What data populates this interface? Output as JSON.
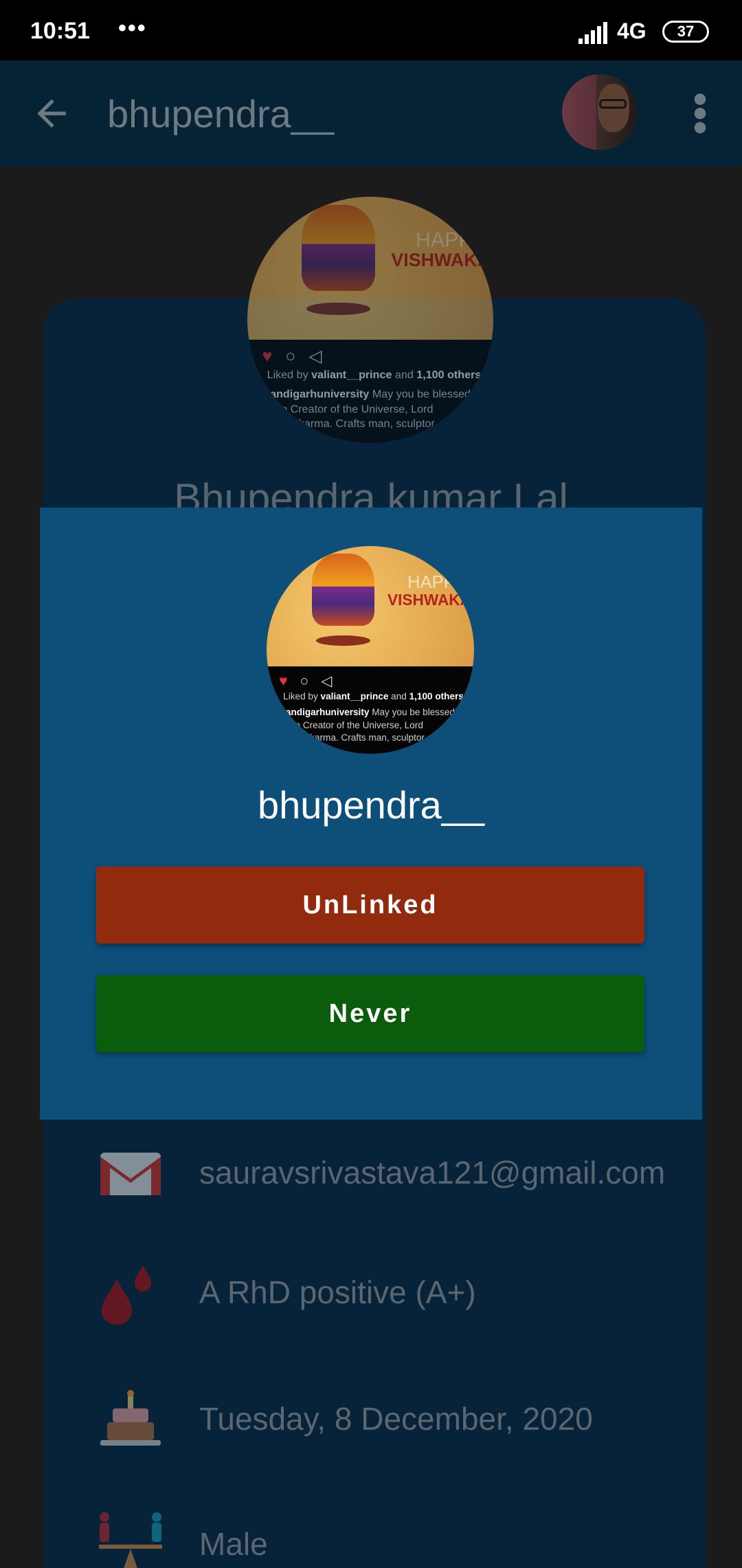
{
  "status_bar": {
    "time": "10:51",
    "dots": "•••",
    "network": "4G",
    "battery": "37"
  },
  "app_bar": {
    "title": "bhupendra__"
  },
  "profile": {
    "name": "Bhupendra kumar Lal",
    "email": "sauravsrivastava121@gmail.com",
    "blood_group": "A RhD positive (A+)",
    "birthday": "Tuesday, 8 December, 2020",
    "gender": "Male"
  },
  "post": {
    "happy": "HAPPY",
    "vish": "VISHWAKA",
    "likes_prefix": "Liked by",
    "likes_user": "valiant__prince",
    "likes_and": "and",
    "likes_count": "1,100 others",
    "caption_user": "chandigarhuniversity",
    "caption_text": "May you be blessed by the Creator of the Universe, Lord #Vishwakarma. Crafts man, sculptor, architect and..."
  },
  "dialog": {
    "username": "bhupendra__",
    "unlinked_label": "UnLinked",
    "never_label": "Never"
  },
  "colors": {
    "dialog_bg": "#0e4f7a",
    "unlinked_btn": "#922a0e",
    "never_btn": "#0b5c0d",
    "app_bar": "#062336"
  },
  "icons": {
    "back": "arrow-left-icon",
    "more": "more-vert-icon",
    "email": "gmail-icon",
    "blood": "blood-drop-icon",
    "birthday": "cake-icon",
    "gender": "gender-icon"
  }
}
